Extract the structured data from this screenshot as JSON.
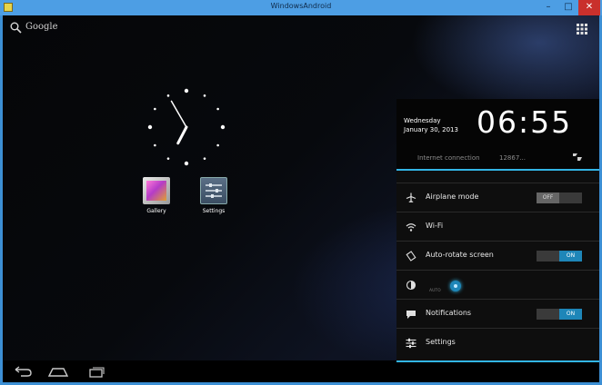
{
  "window": {
    "title": "WindowsAndroid"
  },
  "home": {
    "search_label": "Google",
    "apps": [
      {
        "label": "Gallery",
        "icon": "gallery-icon"
      },
      {
        "label": "Settings",
        "icon": "settings-icon"
      }
    ],
    "clock": {
      "hour": 6,
      "minute": 55
    }
  },
  "panel": {
    "weekday": "Wednesday",
    "date": "January 30, 2013",
    "time": "06:55",
    "connection_label": "Internet connection",
    "connection_value": "12867...",
    "items": {
      "airplane": {
        "label": "Airplane mode",
        "state": "OFF"
      },
      "wifi": {
        "label": "Wi-Fi"
      },
      "rotate": {
        "label": "Auto-rotate screen",
        "state": "ON"
      },
      "brightness": {
        "auto_label": "AUTO"
      },
      "notifications": {
        "label": "Notifications",
        "state": "ON"
      },
      "settings": {
        "label": "Settings"
      }
    }
  },
  "colors": {
    "accent": "#33b5e5",
    "toggle_on": "#1e86b8",
    "title_bar": "#4d9ee4",
    "close_button": "#c9302c"
  }
}
